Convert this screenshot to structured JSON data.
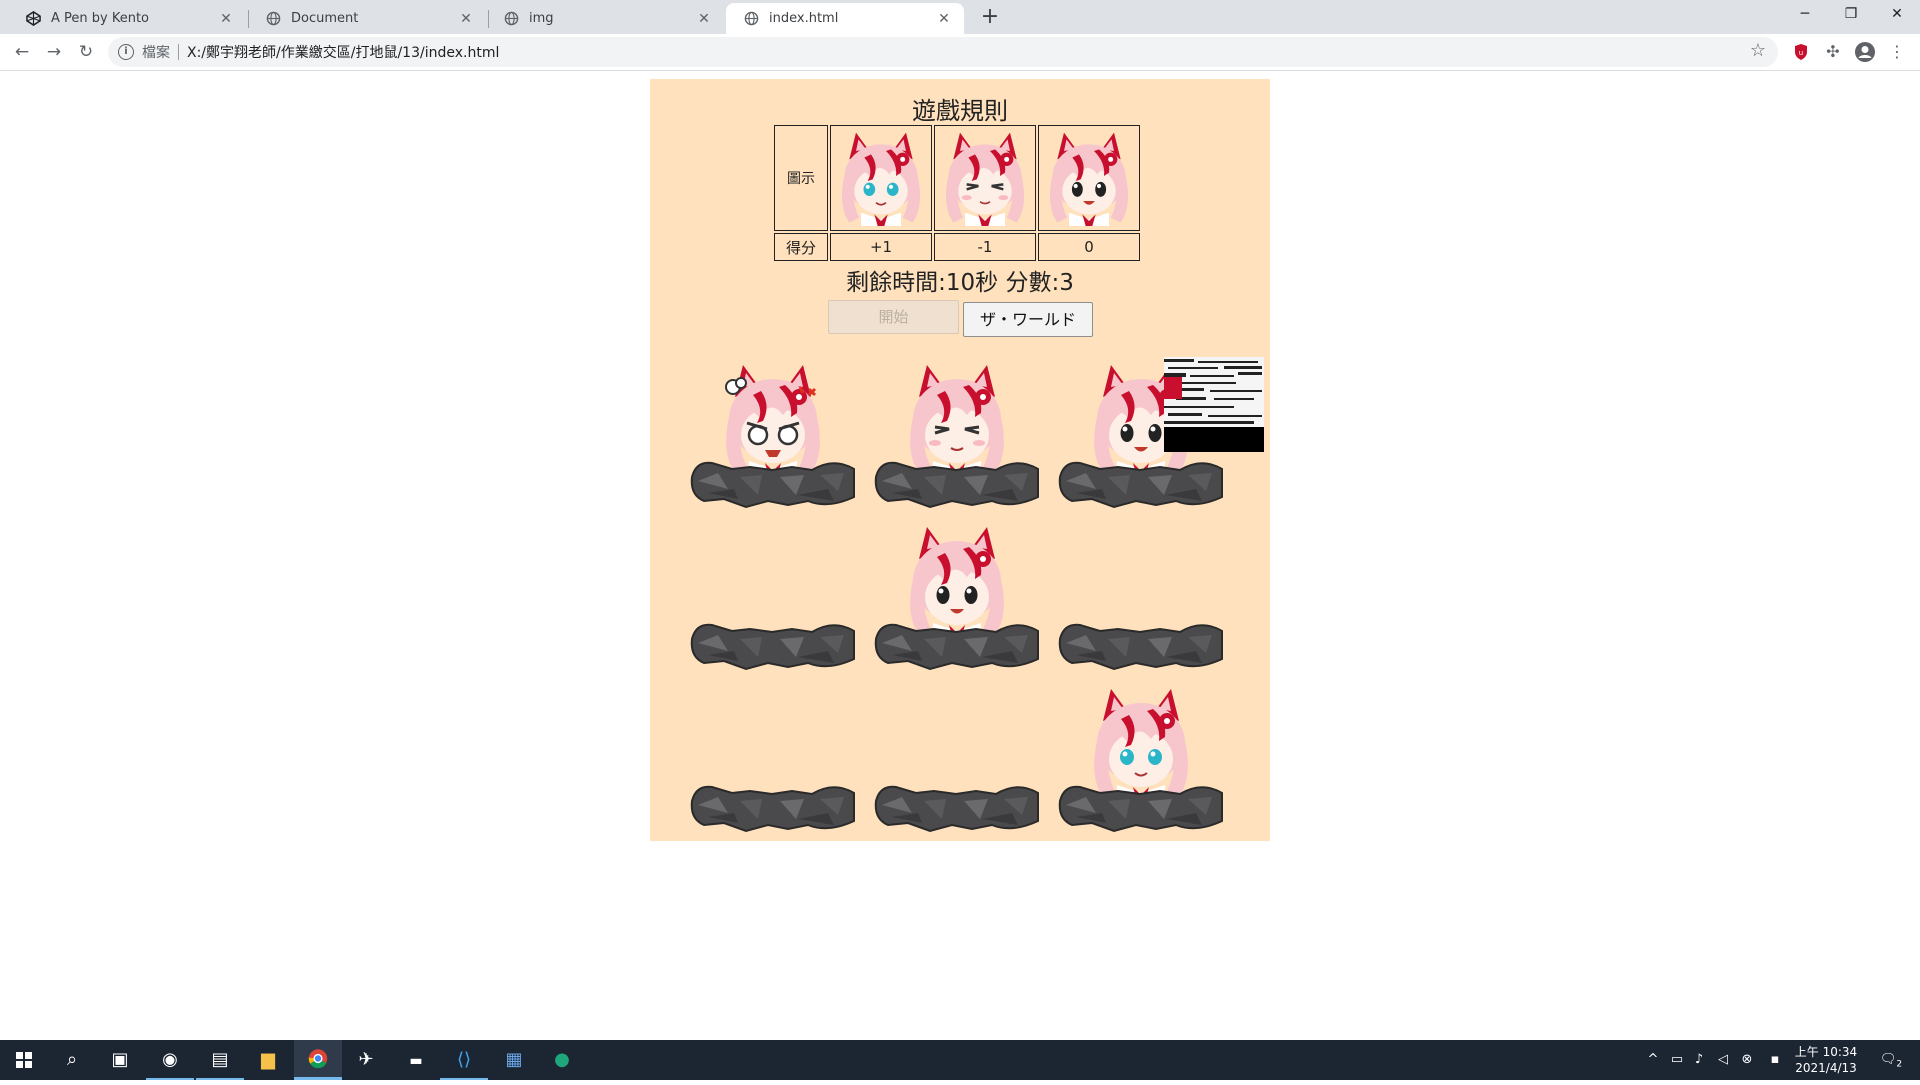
{
  "browser": {
    "tabs": [
      {
        "title": "A Pen by Kento",
        "icon": "codepen-icon"
      },
      {
        "title": "Document",
        "icon": "globe-icon"
      },
      {
        "title": "img",
        "icon": "globe-icon"
      },
      {
        "title": "index.html",
        "icon": "globe-icon",
        "active": true
      }
    ],
    "new_tab_label": "+",
    "address": {
      "scheme": "檔案",
      "url": "X:/鄭宇翔老師/作業繳交區/打地鼠/13/index.html"
    }
  },
  "game": {
    "rules_title": "遊戲規則",
    "rules_table": {
      "icon_label": "圖示",
      "score_label": "得分",
      "entries": [
        {
          "face": "blue-eyes-smile",
          "score": "+1"
        },
        {
          "face": "eyes-closed",
          "score": "-1"
        },
        {
          "face": "dark-eyes",
          "score": "0"
        }
      ]
    },
    "status": "剩餘時間:10秒 分數:3",
    "start_button": "開始",
    "world_button": "ザ・ワールド",
    "holes": [
      {
        "occupant": "angry"
      },
      {
        "occupant": "eyes-closed"
      },
      {
        "occupant": "dark-eyes"
      },
      {
        "occupant": "empty"
      },
      {
        "occupant": "dark-eyes"
      },
      {
        "occupant": "empty"
      },
      {
        "occupant": "empty"
      },
      {
        "occupant": "empty"
      },
      {
        "occupant": "blue-eyes-smile"
      }
    ]
  },
  "colors": {
    "game_bg": "#ffe1bd",
    "hair_red": "#c8102e",
    "hair_pink": "#f7c6cc",
    "rock": "#4a4a4c"
  },
  "taskbar": {
    "clock_time": "上午 10:34",
    "clock_date": "2021/4/13",
    "notification_count": "2"
  }
}
